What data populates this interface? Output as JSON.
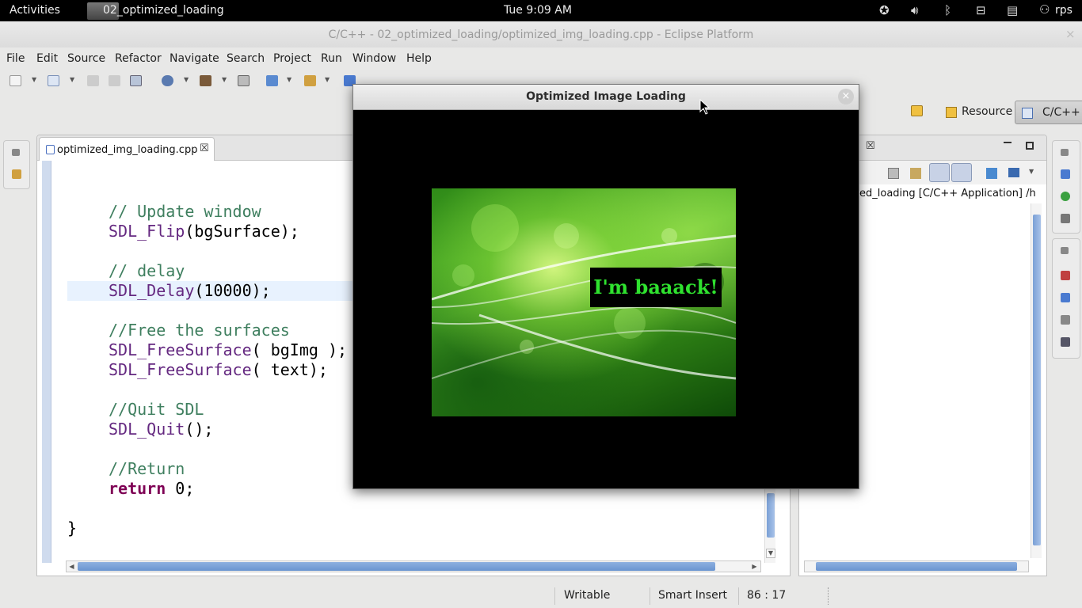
{
  "topbar": {
    "activities": "Activities",
    "app_title": "02_optimized_loading",
    "clock": "Tue  9:09 AM",
    "user": "rps",
    "tray_icons": [
      "accessibility-icon",
      "volume-icon",
      "bluetooth-icon",
      "network-icon",
      "battery-icon"
    ]
  },
  "window": {
    "title": "C/C++ - 02_optimized_loading/optimized_img_loading.cpp - Eclipse Platform",
    "close": "×"
  },
  "menu": [
    "File",
    "Edit",
    "Source",
    "Refactor",
    "Navigate",
    "Search",
    "Project",
    "Run",
    "Window",
    "Help"
  ],
  "perspectives": {
    "resource": "Resource",
    "cpp": "C/C++"
  },
  "editor": {
    "tab_label": "optimized_img_loading.cpp",
    "tab_close": "☒",
    "code_lines": [
      {
        "kind": "comment",
        "text": "// Update window"
      },
      {
        "kind": "call",
        "fn": "SDL_Flip",
        "rest": "(bgSurface);"
      },
      {
        "kind": "comment",
        "text": "// delay"
      },
      {
        "kind": "call",
        "fn": "SDL_Delay",
        "rest": "(10000);"
      },
      {
        "kind": "comment",
        "text": "//Free the surfaces"
      },
      {
        "kind": "call",
        "fn": "SDL_FreeSurface",
        "rest": "( bgImg );"
      },
      {
        "kind": "call",
        "fn": "SDL_FreeSurface",
        "rest": "( text);"
      },
      {
        "kind": "comment",
        "text": "//Quit SDL"
      },
      {
        "kind": "call",
        "fn": "SDL_Quit",
        "rest": "();"
      },
      {
        "kind": "comment",
        "text": "//Return"
      },
      {
        "kind": "keyword",
        "kw": "return",
        "rest": " 0;"
      },
      {
        "kind": "plain",
        "text": "}"
      }
    ]
  },
  "right_view": {
    "tab_close": "☒",
    "process_label": "ed_loading [C/C++ Application] /h"
  },
  "status": {
    "writable": "Writable",
    "insert_mode": "Smart Insert",
    "position": "86 : 17"
  },
  "sdl_window": {
    "title": "Optimized Image Loading",
    "close": "×",
    "caption": "I'm baaack!",
    "caption_color": "#2fe22f"
  }
}
